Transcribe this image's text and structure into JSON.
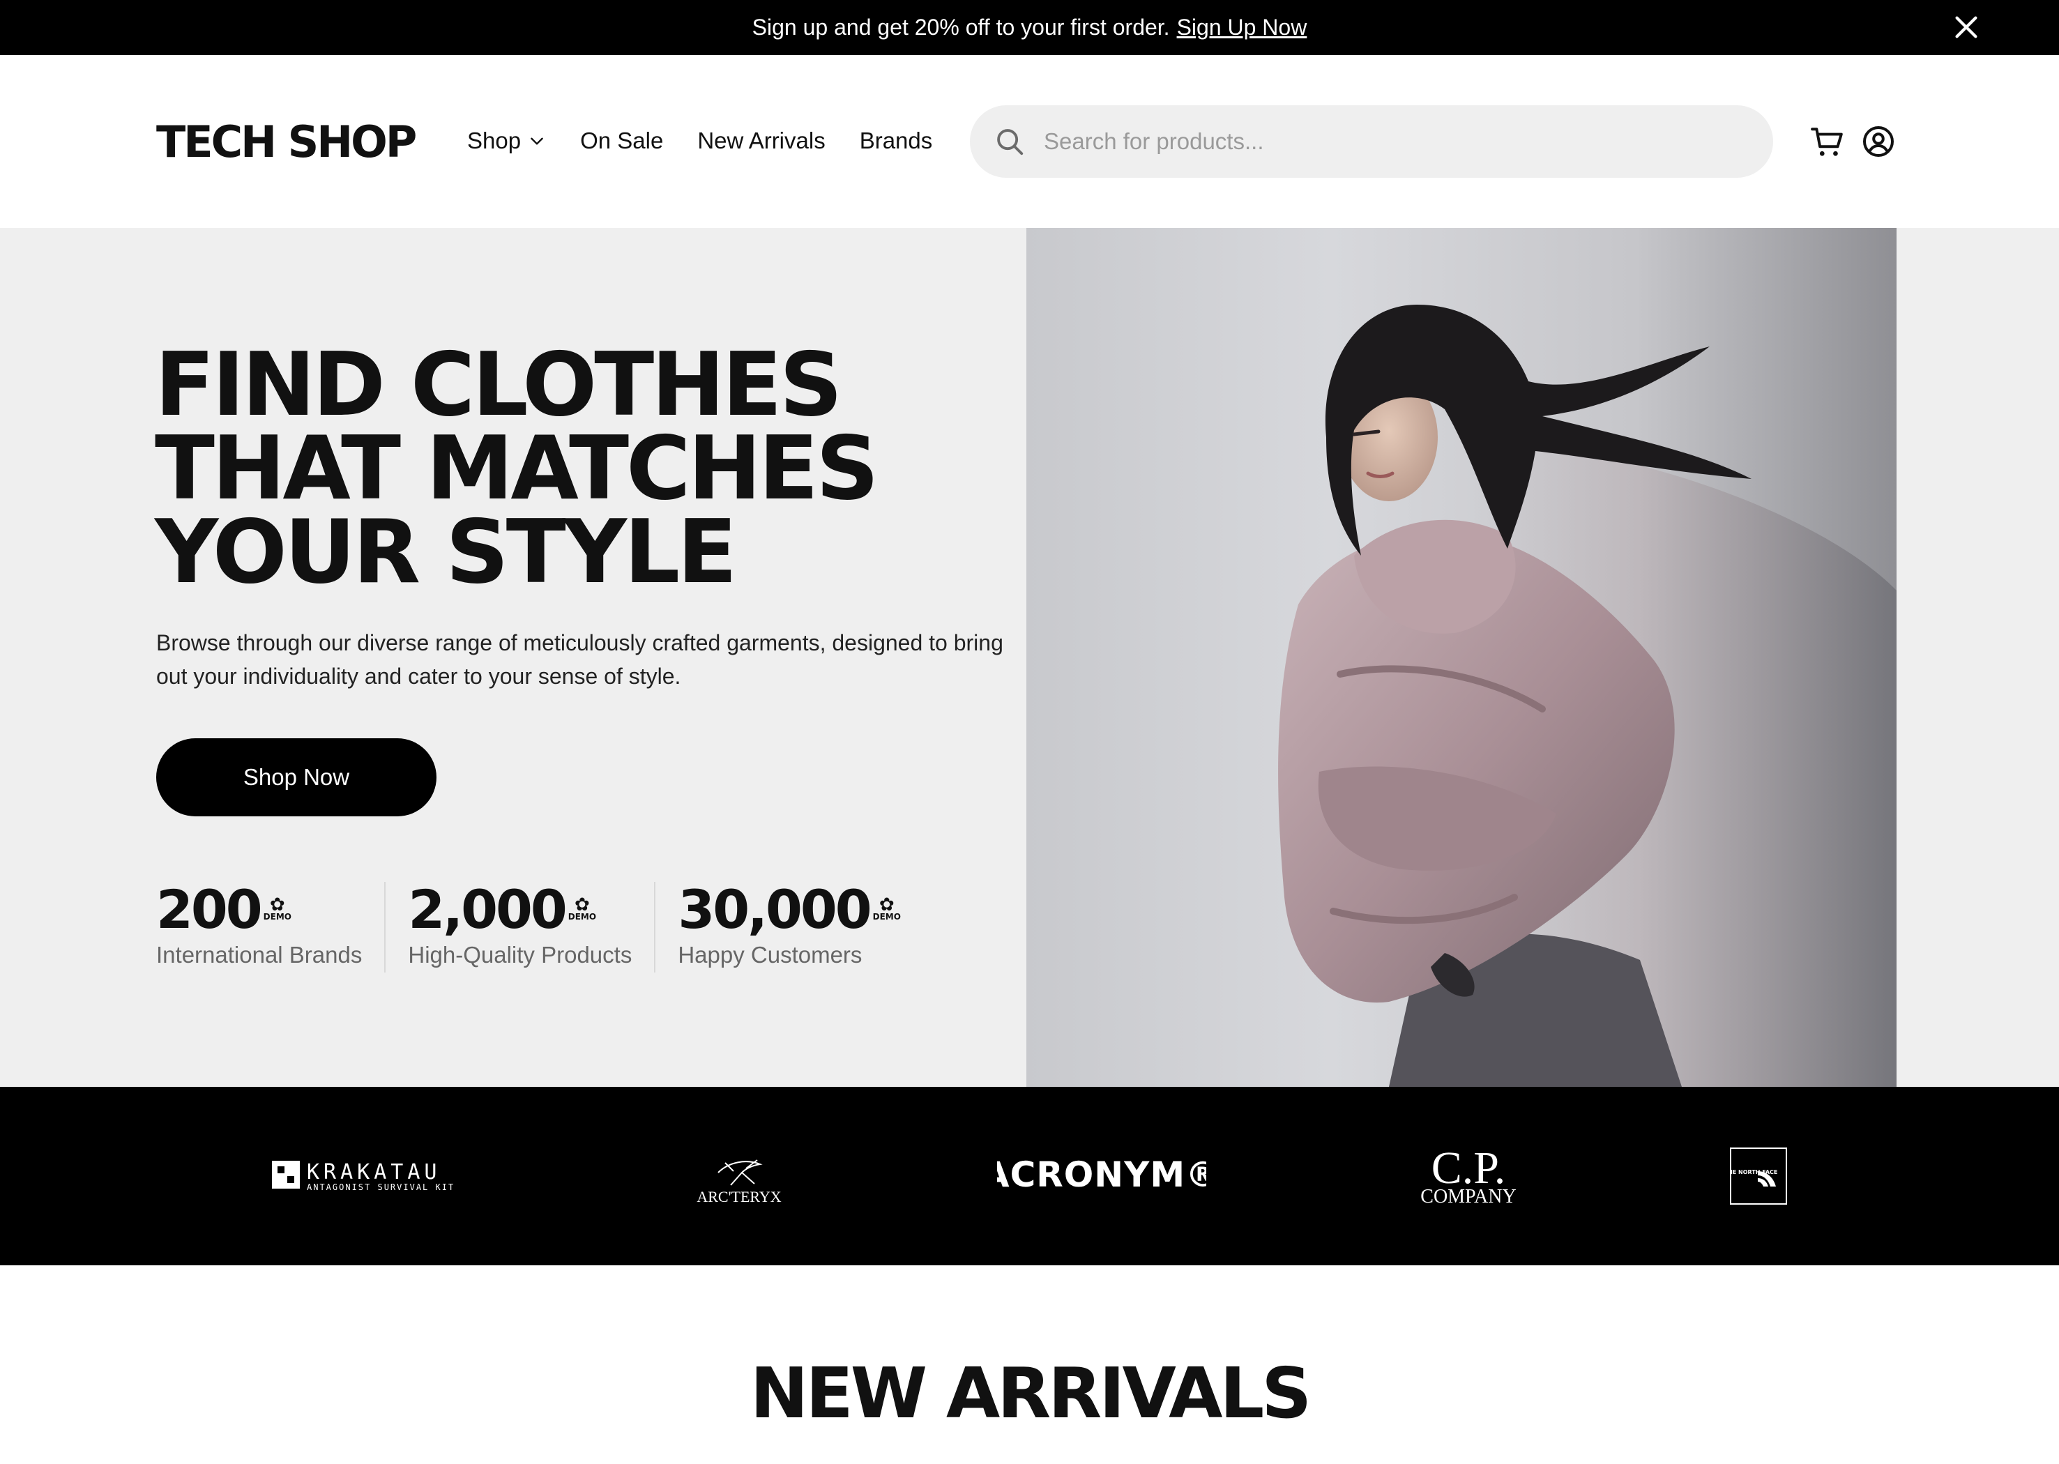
{
  "announcement": {
    "text": "Sign up and get 20% off to your first order.",
    "link": "Sign Up Now"
  },
  "header": {
    "logo": "TECH SHOP",
    "nav": {
      "shop": "Shop",
      "on_sale": "On Sale",
      "new_arrivals": "New Arrivals",
      "brands": "Brands"
    },
    "search_placeholder": "Search for products..."
  },
  "hero": {
    "title_lines": [
      "FIND CLOTHES",
      "THAT MATCHES",
      "YOUR STYLE"
    ],
    "description": "Browse through our diverse range of meticulously crafted garments, designed to bring out your individuality and cater to your sense of style.",
    "cta": "Shop Now",
    "stats": [
      {
        "value": "200",
        "mark": "DEMO",
        "label": "International Brands"
      },
      {
        "value": "2,000",
        "mark": "DEMO",
        "label": "High-Quality Products"
      },
      {
        "value": "30,000",
        "mark": "DEMO",
        "label": "Happy Customers"
      }
    ]
  },
  "brands": {
    "krakatau": "KRAKATAU",
    "krakatau_sub": "ANTAGONIST SURVIVAL KIT",
    "arcteryx": "ARC'TERYX",
    "acronym": "ACRONYM®",
    "cp_top": "C.P.",
    "cp_bottom": "COMPANY",
    "tnf": "THE NORTH FACE"
  },
  "new_arrivals": {
    "title": "NEW ARRIVALS"
  },
  "colors": {
    "primary": "#000000",
    "hero_bg": "#efefef",
    "muted_text": "#666666"
  }
}
